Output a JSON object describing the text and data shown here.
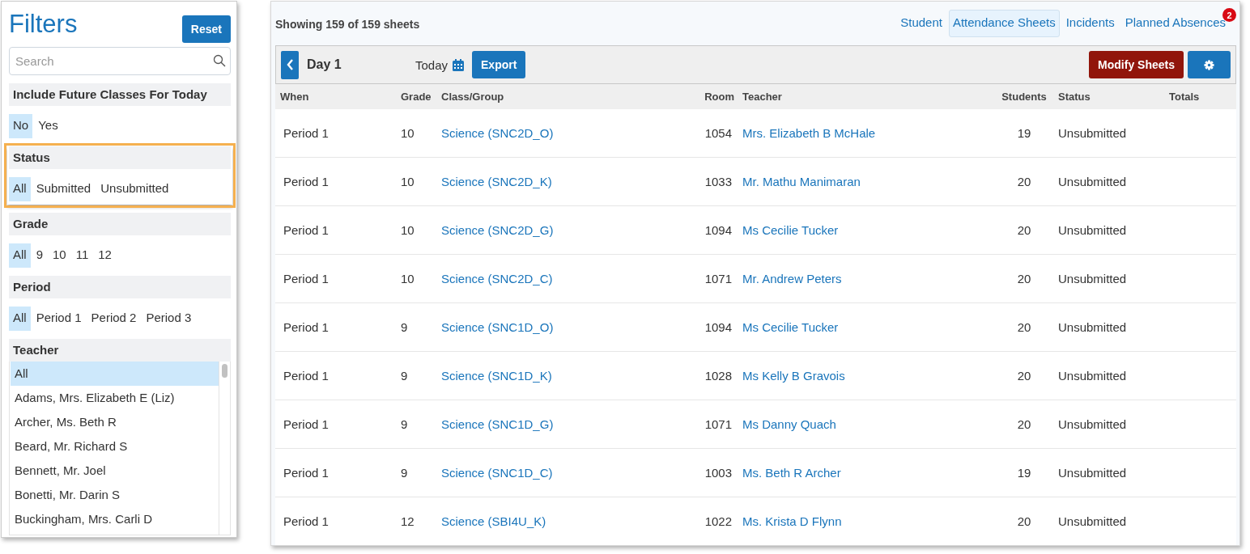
{
  "filters": {
    "title": "Filters",
    "reset_button": "Reset",
    "search": {
      "placeholder": "Search"
    },
    "groups": [
      {
        "title": "Include Future Classes For Today",
        "highlighted": false,
        "options": [
          {
            "label": "No",
            "selected": true
          },
          {
            "label": "Yes",
            "selected": false
          }
        ]
      },
      {
        "title": "Status",
        "highlighted": true,
        "options": [
          {
            "label": "All",
            "selected": true
          },
          {
            "label": "Submitted",
            "selected": false
          },
          {
            "label": "Unsubmitted",
            "selected": false
          }
        ]
      },
      {
        "title": "Grade",
        "highlighted": false,
        "options": [
          {
            "label": "All",
            "selected": true
          },
          {
            "label": "9",
            "selected": false
          },
          {
            "label": "10",
            "selected": false
          },
          {
            "label": "11",
            "selected": false
          },
          {
            "label": "12",
            "selected": false
          }
        ]
      },
      {
        "title": "Period",
        "highlighted": false,
        "options": [
          {
            "label": "All",
            "selected": true
          },
          {
            "label": "Period 1",
            "selected": false
          },
          {
            "label": "Period 2",
            "selected": false
          },
          {
            "label": "Period 3",
            "selected": false
          }
        ]
      }
    ],
    "teacher": {
      "title": "Teacher",
      "items": [
        {
          "label": "All",
          "selected": true
        },
        {
          "label": "Adams, Mrs. Elizabeth E (Liz)",
          "selected": false
        },
        {
          "label": "Archer, Ms. Beth R",
          "selected": false
        },
        {
          "label": "Beard, Mr. Richard S",
          "selected": false
        },
        {
          "label": "Bennett, Mr. Joel",
          "selected": false
        },
        {
          "label": "Bonetti, Mr. Darin S",
          "selected": false
        },
        {
          "label": "Buckingham, Mrs. Carli D",
          "selected": false
        }
      ]
    }
  },
  "main": {
    "summary": "Showing 159 of 159 sheets",
    "tabs": [
      {
        "label": "Student",
        "selected": false
      },
      {
        "label": "Attendance Sheets",
        "selected": true
      },
      {
        "label": "Incidents",
        "selected": false
      },
      {
        "label": "Planned Absences",
        "selected": false,
        "badge": "2"
      }
    ],
    "toolbar": {
      "day": "Day 1",
      "date": "Today",
      "export_button": "Export",
      "modify_button": "Modify Sheets"
    },
    "table": {
      "columns": [
        "When",
        "Grade",
        "Class/Group",
        "Room",
        "Teacher",
        "Students",
        "Status",
        "Totals"
      ],
      "rows": [
        {
          "when": "Period 1",
          "grade": "10",
          "class": "Science (SNC2D_O)",
          "room": "1054",
          "teacher": "Mrs. Elizabeth B McHale",
          "students": "19",
          "status": "Unsubmitted"
        },
        {
          "when": "Period 1",
          "grade": "10",
          "class": "Science (SNC2D_K)",
          "room": "1033",
          "teacher": "Mr. Mathu Manimaran",
          "students": "20",
          "status": "Unsubmitted"
        },
        {
          "when": "Period 1",
          "grade": "10",
          "class": "Science (SNC2D_G)",
          "room": "1094",
          "teacher": "Ms Cecilie Tucker",
          "students": "20",
          "status": "Unsubmitted"
        },
        {
          "when": "Period 1",
          "grade": "10",
          "class": "Science (SNC2D_C)",
          "room": "1071",
          "teacher": "Mr. Andrew Peters",
          "students": "20",
          "status": "Unsubmitted"
        },
        {
          "when": "Period 1",
          "grade": "9",
          "class": "Science (SNC1D_O)",
          "room": "1094",
          "teacher": "Ms Cecilie Tucker",
          "students": "20",
          "status": "Unsubmitted"
        },
        {
          "when": "Period 1",
          "grade": "9",
          "class": "Science (SNC1D_K)",
          "room": "1028",
          "teacher": "Ms Kelly B Gravois",
          "students": "20",
          "status": "Unsubmitted"
        },
        {
          "when": "Period 1",
          "grade": "9",
          "class": "Science (SNC1D_G)",
          "room": "1071",
          "teacher": "Ms Danny Quach",
          "students": "20",
          "status": "Unsubmitted"
        },
        {
          "when": "Period 1",
          "grade": "9",
          "class": "Science (SNC1D_C)",
          "room": "1003",
          "teacher": "Ms. Beth R Archer",
          "students": "19",
          "status": "Unsubmitted"
        },
        {
          "when": "Period 1",
          "grade": "12",
          "class": "Science (SBI4U_K)",
          "room": "1022",
          "teacher": "Ms. Krista D Flynn",
          "students": "20",
          "status": "Unsubmitted"
        }
      ]
    }
  }
}
